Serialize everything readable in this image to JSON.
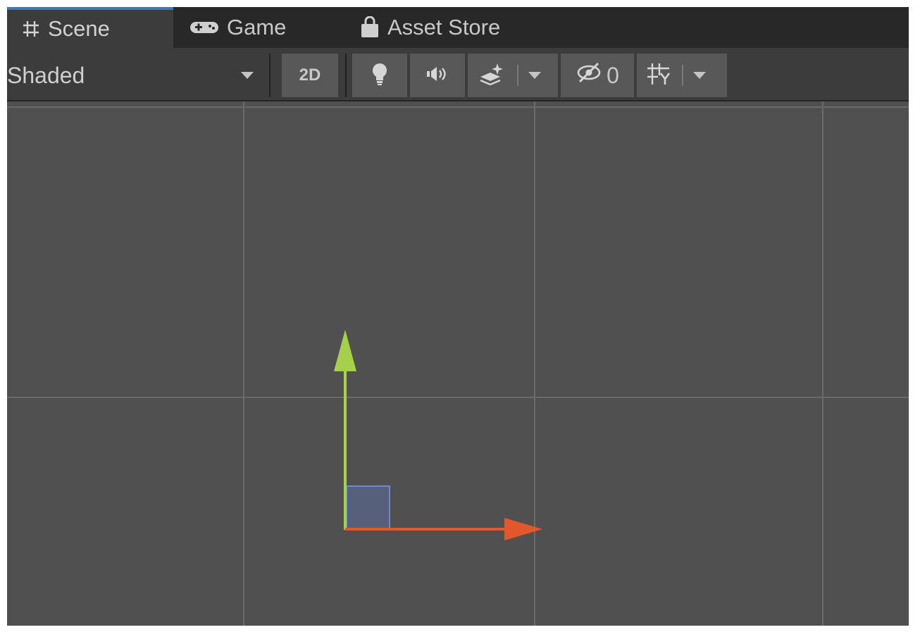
{
  "tabs": [
    {
      "label": "Scene",
      "icon": "scene-grid-icon",
      "active": true
    },
    {
      "label": "Game",
      "icon": "gamepad-icon",
      "active": false
    },
    {
      "label": "Asset Store",
      "icon": "shopping-bag-icon",
      "active": false
    }
  ],
  "toolbar": {
    "draw_mode": "Shaded",
    "toggle_2d_label": "2D",
    "hidden_objects_count": "0",
    "icons": [
      "lightbulb-icon",
      "audio-icon",
      "effects-icon",
      "visibility-icon",
      "grid-icon"
    ]
  },
  "gizmo": {
    "x_axis_color": "#e2582c",
    "y_axis_color": "#a6d04c",
    "rect_fill": "#56607a",
    "rect_stroke": "#6a8ad2"
  },
  "colors": {
    "accent": "#3a79bb",
    "viewport_bg": "#505050",
    "grid_line": "#6a6a6a"
  }
}
